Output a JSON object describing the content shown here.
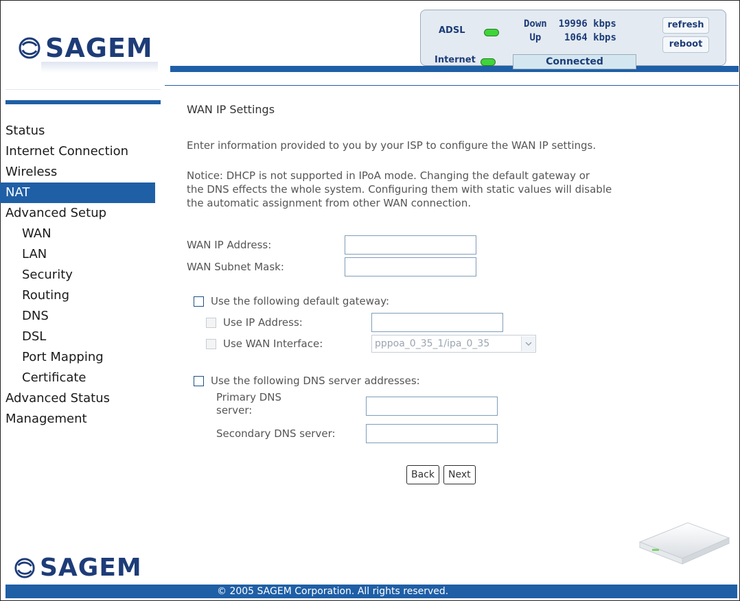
{
  "brand": {
    "name": "SAGEM"
  },
  "status": {
    "adsl_label": "ADSL",
    "internet_label": "Internet",
    "down_label": "Down",
    "down_rate": "19996 kbps",
    "up_label": "Up",
    "up_rate": "1064 kbps",
    "connection_status": "Connected",
    "refresh_label": "refresh",
    "reboot_label": "reboot",
    "led_color": "#3fd43a"
  },
  "nav": {
    "items": [
      {
        "label": "Status",
        "level": 0
      },
      {
        "label": "Internet Connection",
        "level": 0
      },
      {
        "label": "Wireless",
        "level": 0
      },
      {
        "label": "NAT",
        "level": 0,
        "active": true
      },
      {
        "label": "Advanced Setup",
        "level": 0
      },
      {
        "label": "WAN",
        "level": 1
      },
      {
        "label": "LAN",
        "level": 1
      },
      {
        "label": "Security",
        "level": 1
      },
      {
        "label": "Routing",
        "level": 1
      },
      {
        "label": "DNS",
        "level": 1
      },
      {
        "label": "DSL",
        "level": 1
      },
      {
        "label": "Port Mapping",
        "level": 1
      },
      {
        "label": "Certificate",
        "level": 1
      },
      {
        "label": "Advanced Status",
        "level": 0
      },
      {
        "label": "Management",
        "level": 0
      }
    ]
  },
  "main": {
    "title": "WAN IP Settings",
    "intro": "Enter information provided to you by your ISP to configure the WAN IP settings.",
    "notice_lines": [
      "Notice: DHCP is not supported in IPoA mode. Changing the default gateway or",
      "the DNS effects the whole system. Configuring them with static values will disable",
      "the automatic assignment from other WAN connection."
    ],
    "wan_ip_label": "WAN IP Address:",
    "wan_ip_value": "",
    "wan_mask_label": "WAN Subnet Mask:",
    "wan_mask_value": "",
    "gateway_checkbox_label": "Use the following default gateway:",
    "use_ip_label": "Use IP Address:",
    "use_ip_value": "",
    "use_wan_if_label": "Use WAN Interface:",
    "wan_if_selected": "pppoa_0_35_1/ipa_0_35",
    "dns_checkbox_label": "Use the following DNS server addresses:",
    "primary_dns_label_line1": "Primary DNS",
    "primary_dns_label_line2": "server:",
    "primary_dns_value": "",
    "secondary_dns_label": "Secondary DNS server:",
    "secondary_dns_value": "",
    "back_label": "Back",
    "next_label": "Next"
  },
  "footer": {
    "copyright": "© 2005 SAGEM Corporation. All rights reserved."
  },
  "colors": {
    "brand_blue": "#1f5fa6",
    "logo_navy": "#1d3c78"
  }
}
